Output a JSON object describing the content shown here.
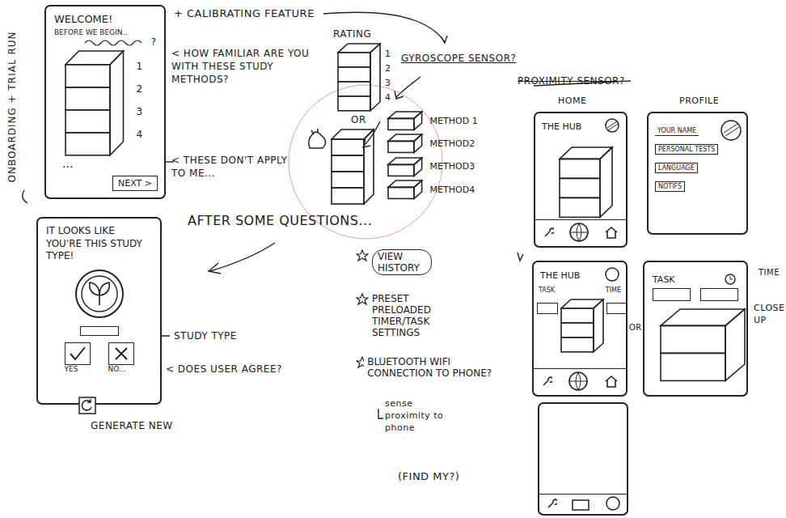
{
  "side_label": "ONBOARDING + TRIAL RUN",
  "welcome_screen": {
    "title": "WELCOME!",
    "subtitle": "BEFORE WE BEGIN..",
    "question": "?",
    "ratings": [
      "1",
      "2",
      "3",
      "4"
    ],
    "ellipsis": "...",
    "next_button": "NEXT >"
  },
  "calibration": {
    "title": "+ CALIBRATING FEATURE",
    "rating_label": "RATING",
    "ratings": [
      "1",
      "2",
      "3",
      "4"
    ],
    "or": "OR",
    "methods": [
      "METHOD 1",
      "METHOD2",
      "METHOD3",
      "METHOD4"
    ],
    "sensor": "GYROSCOPE SENSOR?"
  },
  "notes": {
    "familiar": "< HOW FAMILIAR ARE YOU WITH THESE STUDY METHODS?",
    "not_apply": "< THESE DON'T APPLY TO ME...",
    "after": "AFTER SOME QUESTIONS...",
    "proximity": {
      "text": "PROXIMITY SENSOR?",
      "crossed": true
    }
  },
  "result_screen": {
    "title": "IT LOOKS LIKE YOU'RE THIS STUDY TYPE!",
    "yes": "YES",
    "no": "NO...",
    "study_type_label": "STUDY TYPE",
    "agree_note": "< DOES USER AGREE?",
    "generate": "GENERATE NEW"
  },
  "features": [
    {
      "text": "VIEW HISTORY",
      "circled": true
    },
    {
      "text": "PRESET PRELOADED TIMER/TASK SETTINGS",
      "circled": false
    },
    {
      "text": "BLUETOOTH WIFI CONNECTION TO PHONE?",
      "circled": false
    }
  ],
  "proximity_note": {
    "text": "sense proximity to phone",
    "find": "(FIND MY?)"
  },
  "home": {
    "label": "HOME",
    "title": "THE HUB"
  },
  "profile": {
    "label": "PROFILE",
    "fields": [
      "YOUR NAME",
      "PERSONAL TESTS",
      "LANGUAGE",
      "NOTIFS"
    ]
  },
  "hub_tasks": {
    "title": "THE HUB",
    "task": "TASK",
    "time": "TIME",
    "or": "OR"
  },
  "closeup": {
    "task": "TASK",
    "time_note": "TIME",
    "label": "CLOSE UP"
  }
}
